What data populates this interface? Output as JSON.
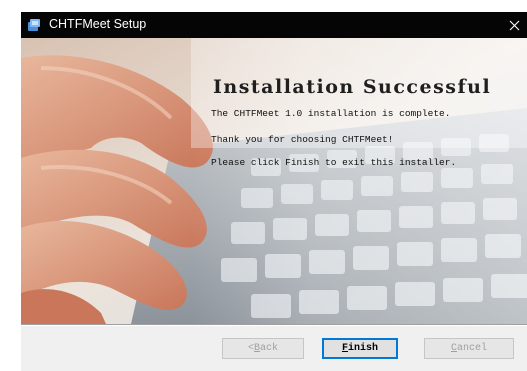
{
  "window": {
    "title": "CHTFMeet Setup",
    "close_glyph": "✕"
  },
  "content": {
    "heading": "Installation Successful",
    "line1": "The CHTFMeet 1.0 installation is complete.",
    "line2": "Thank you for choosing CHTFMeet!",
    "line3": "Please click Finish to exit this installer."
  },
  "buttons": {
    "back": {
      "accel": "B",
      "rest": "ack",
      "prefix": "< "
    },
    "finish": {
      "accel": "F",
      "rest": "inish"
    },
    "cancel": {
      "accel": "C",
      "rest": "ancel"
    }
  },
  "icons": {
    "app": "setup-package-icon",
    "close": "close-icon"
  },
  "colors": {
    "titlebar": "#050505",
    "dialog": "#f0f0f0",
    "focus_border": "#0078d7"
  }
}
